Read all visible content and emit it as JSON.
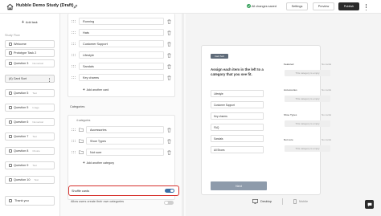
{
  "topbar": {
    "title": "Hubble Demo Study (Draft)",
    "saved_status": "All changes saved",
    "settings_label": "Settings",
    "preview_label": "Preview",
    "publish_label": "Publish"
  },
  "sidebar": {
    "add_task_label": "Add task",
    "study_flow_label": "Study Flow",
    "items": [
      {
        "label": "Welcome",
        "type": ""
      },
      {
        "label": "Prototype Task 2",
        "type": ""
      },
      {
        "label": "Question 3",
        "type": "Numerical"
      },
      {
        "label": "(4) Card Sort",
        "type": ""
      },
      {
        "label": "Question 5",
        "type": "Text"
      },
      {
        "label": "Question 5",
        "type": "Image"
      },
      {
        "label": "Question 6",
        "type": "Numerical"
      },
      {
        "label": "Question 7",
        "type": "Text"
      },
      {
        "label": "Question 8",
        "type": "Choice"
      },
      {
        "label": "Question 9",
        "type": "Text"
      },
      {
        "label": "Question 10",
        "type": "Text"
      }
    ],
    "thank_you_label": "Thank you"
  },
  "editor": {
    "cards": [
      "Running",
      "Hats",
      "Customer Support",
      "Lifestyle",
      "Sandals",
      "Key charms"
    ],
    "add_card_label": "Add another card",
    "categories_title": "Categories",
    "categories_count": "4 categories",
    "categories": [
      "Accessories",
      "Shoe Types",
      "Not sure"
    ],
    "add_category_label": "Add another category",
    "shuffle_label": "Shuffle cards",
    "shuffle_on": true,
    "allow_label": "Allow users create their own categories",
    "allow_on": false
  },
  "preview": {
    "tag": "Card Sort",
    "prompt": "Assign each item in the left to a category that you see fit.",
    "cards": [
      "Lifestyle",
      "Customer Support",
      "Key charms",
      "FAQ",
      "Sandals",
      "All Shoes"
    ],
    "next_label": "Next",
    "categories": [
      {
        "name": "Featured",
        "count": "No cards",
        "empty": "This category is empty"
      },
      {
        "name": "Accessories",
        "count": "No cards",
        "empty": "This category is empty"
      },
      {
        "name": "Shoe Types",
        "count": "No cards",
        "empty": "This category is empty"
      },
      {
        "name": "Not sure",
        "count": "No cards",
        "empty": "This category is empty"
      }
    ],
    "desktop_label": "Desktop",
    "mobile_label": "Mobile"
  },
  "colors": {
    "accent_toggle": "#3b6ea5",
    "highlight_border": "#d7322d",
    "publish_bg": "#2b2b2b",
    "saved_check": "#2e9d55"
  }
}
